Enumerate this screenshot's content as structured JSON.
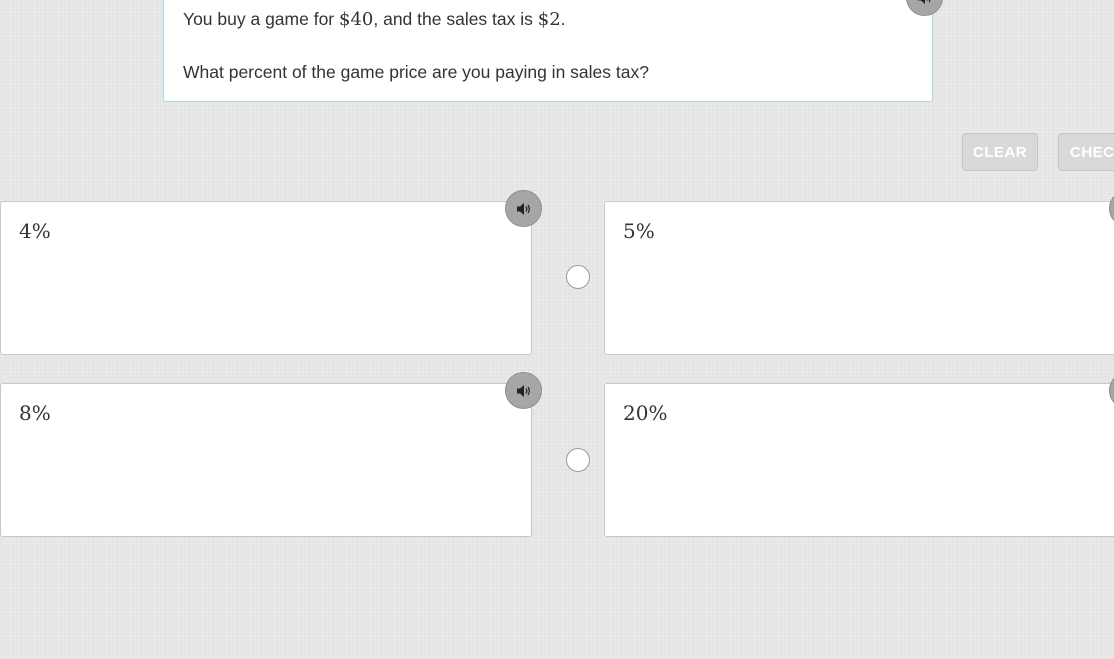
{
  "question": {
    "line1_prefix": "You buy a game for ",
    "line1_price": "$40",
    "line1_middle": ", and the sales tax is ",
    "line1_tax": "$2",
    "line1_suffix": ".",
    "line2": "What percent of the game price are you paying in sales tax?"
  },
  "toolbar": {
    "clear_label": "CLEAR",
    "check_label": "CHECK"
  },
  "choices": [
    {
      "label": "4%"
    },
    {
      "label": "5%"
    },
    {
      "label": "8%"
    },
    {
      "label": "20%"
    }
  ],
  "icons": {
    "audio": "speaker-icon",
    "radio": "radio-button"
  },
  "colors": {
    "question_border": "#a9d6e5",
    "audio_button": "#a6a6a6",
    "disabled_button": "#d9d9d9",
    "background": "#e7e7e7"
  }
}
